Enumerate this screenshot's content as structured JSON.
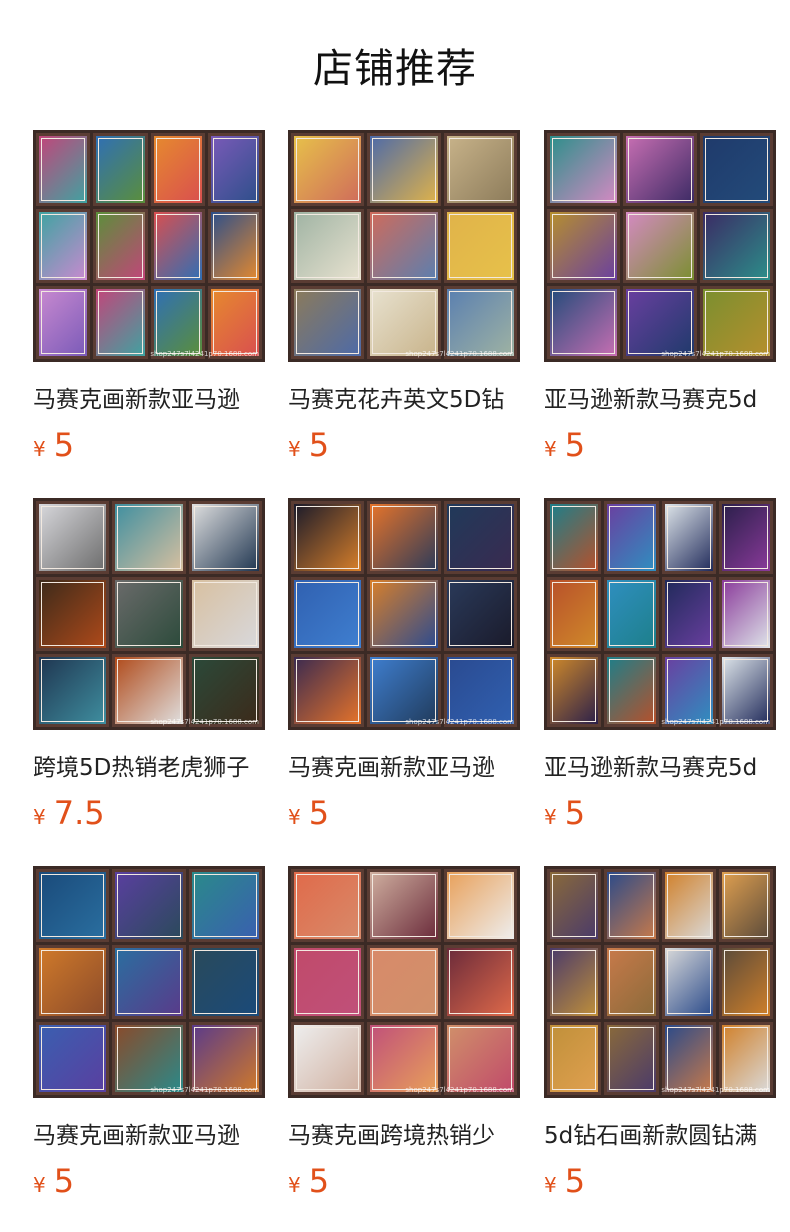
{
  "page": {
    "title": "店铺推荐"
  },
  "products": [
    {
      "name": "马赛克画新款亚马逊",
      "currency": "¥",
      "price": "5",
      "palette": [
        "#c2457a",
        "#2f6fb5",
        "#e68a2e",
        "#7a5ab8",
        "#3fa3a1",
        "#5b8f3a",
        "#d94f4f",
        "#2d4f8a",
        "#c98ad0"
      ]
    },
    {
      "name": "马赛克花卉英文5D钻",
      "currency": "¥",
      "price": "5",
      "palette": [
        "#e7c14a",
        "#4d6aa8",
        "#c8b38a",
        "#9fb3a3",
        "#cf6b5b",
        "#e0b34a",
        "#8c7b5a",
        "#e8e2d0",
        "#5a7fb0"
      ]
    },
    {
      "name": "亚马逊新款马赛克5d",
      "currency": "¥",
      "price": "5",
      "palette": [
        "#2c8f8a",
        "#c86fb3",
        "#1f3a6b",
        "#b68f2e",
        "#d58ac3",
        "#3b2a64",
        "#234b7a",
        "#6a3fa0",
        "#7a8f2f"
      ]
    },
    {
      "name": "跨境5D热销老虎狮子",
      "currency": "¥",
      "price": "7.5",
      "palette": [
        "#d8d8dc",
        "#3f8fa0",
        "#e0e0e0",
        "#3c2a1a",
        "#6b6b6b",
        "#d8c0a0",
        "#1f3550",
        "#b04a1a",
        "#2b4a3a"
      ]
    },
    {
      "name": "马赛克画新款亚马逊",
      "currency": "¥",
      "price": "5",
      "palette": [
        "#1a1a2a",
        "#e7742a",
        "#203a5a",
        "#3060b0",
        "#d9802a",
        "#2a3a5a",
        "#3a2a50",
        "#3f7fd0",
        "#2a4a90"
      ]
    },
    {
      "name": "亚马逊新款马赛克5d",
      "currency": "¥",
      "price": "5",
      "palette": [
        "#1d7f8a",
        "#6a3fa0",
        "#dfe6ea",
        "#2a1f4a",
        "#b8502a",
        "#2f8fc0",
        "#202a5a",
        "#8a3a9a",
        "#d08a2a"
      ]
    },
    {
      "name": "马赛克画新款亚马逊",
      "currency": "¥",
      "price": "5",
      "palette": [
        "#1a4a7a",
        "#5a3fa0",
        "#2a8a8a",
        "#d07a2a",
        "#2a6fa0",
        "#2a4a5a",
        "#3a5fb0",
        "#8a4a2a",
        "#5a3a8a"
      ]
    },
    {
      "name": "马赛克画跨境热销少",
      "currency": "¥",
      "price": "5",
      "palette": [
        "#e06a4a",
        "#d0b0a0",
        "#e8a05a",
        "#c04a6a",
        "#d88a6a",
        "#6a2a3a",
        "#eeeeee",
        "#c0507a",
        "#d0906a"
      ]
    },
    {
      "name": "5d钻石画新款圆钻满",
      "currency": "¥",
      "price": "5",
      "palette": [
        "#8a6a3a",
        "#2a4a8a",
        "#d0802a",
        "#e0a050",
        "#4a3a6a",
        "#c87a4a",
        "#dadada",
        "#5a4a3a",
        "#c0903a"
      ]
    }
  ],
  "watermark": "shop247s7l4241p70.1688.com"
}
